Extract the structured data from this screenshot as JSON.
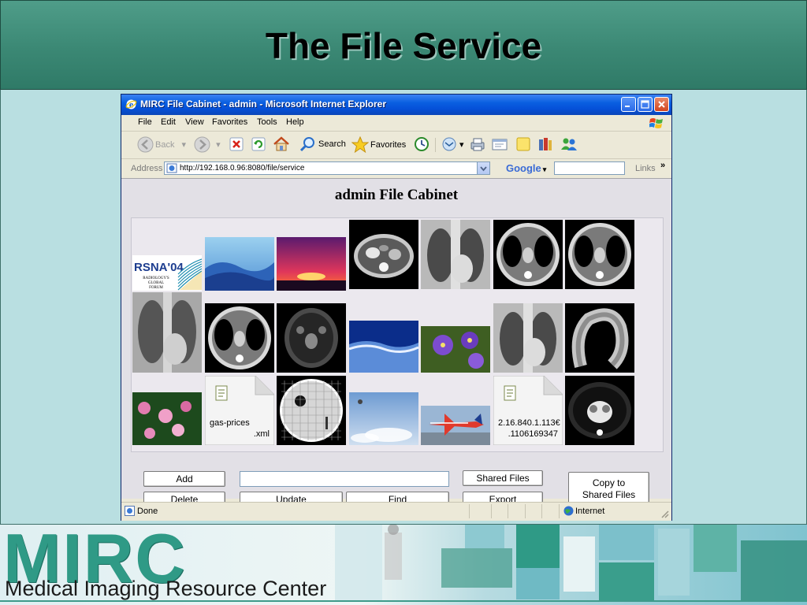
{
  "slide": {
    "title": "The File Service",
    "footer_logo": "MIRC",
    "footer_subtitle": "Medical Imaging Resource Center"
  },
  "browser": {
    "window_title": "MIRC File Cabinet - admin - Microsoft Internet Explorer",
    "menu": [
      "File",
      "Edit",
      "View",
      "Favorites",
      "Tools",
      "Help"
    ],
    "toolbar": {
      "back": "Back",
      "search": "Search",
      "favorites": "Favorites"
    },
    "address_label": "Address",
    "url": "http://192.168.0.96:8080/file/service",
    "google_label": "Google",
    "links_label": "Links",
    "links_chevron": "»",
    "status": "Done",
    "zone": "Internet"
  },
  "page": {
    "heading": "admin File Cabinet",
    "files": [
      {
        "kind": "rsna-logo",
        "logo_text": "RSNA'04",
        "logo_subtext": [
          "RADIOLOGY'S",
          "GLOBAL",
          "FORUM"
        ]
      },
      {
        "kind": "mountains"
      },
      {
        "kind": "sunset"
      },
      {
        "kind": "ct-abdomen"
      },
      {
        "kind": "chest-xray"
      },
      {
        "kind": "ct-chest"
      },
      {
        "kind": "ct-chest"
      },
      {
        "kind": "chest-xray-tall"
      },
      {
        "kind": "ct-chest"
      },
      {
        "kind": "mri-head"
      },
      {
        "kind": "waves"
      },
      {
        "kind": "flowers-purple"
      },
      {
        "kind": "chest-xray"
      },
      {
        "kind": "colon-xray"
      },
      {
        "kind": "water-lilies"
      },
      {
        "kind": "document",
        "name": [
          "gas-prices",
          ".xml"
        ]
      },
      {
        "kind": "phantom"
      },
      {
        "kind": "sky"
      },
      {
        "kind": "airplane"
      },
      {
        "kind": "document",
        "name": [
          "2.16.840.1.113€",
          ".1106169347"
        ]
      },
      {
        "kind": "ct-chest-dark"
      }
    ],
    "buttons": {
      "add": "Add",
      "delete": "Delete",
      "update": "Update",
      "find": "Find",
      "shared_files": "Shared Files",
      "export": "Export",
      "copy_line1": "Copy to",
      "copy_line2": "Shared Files"
    },
    "name_field_value": ""
  },
  "colors": {
    "header": "#3b8874",
    "slide_bg": "#b9dfe1",
    "titlebar": "#0a5fe0",
    "mirc_green": "#2f9a86"
  }
}
